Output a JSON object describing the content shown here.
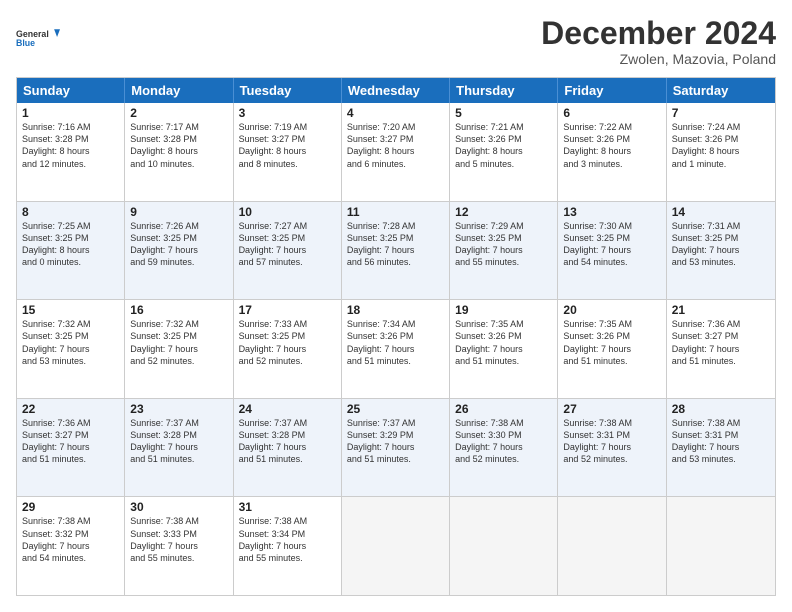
{
  "logo": {
    "line1": "General",
    "line2": "Blue"
  },
  "header": {
    "title": "December 2024",
    "subtitle": "Zwolen, Mazovia, Poland"
  },
  "calendar": {
    "days_of_week": [
      "Sunday",
      "Monday",
      "Tuesday",
      "Wednesday",
      "Thursday",
      "Friday",
      "Saturday"
    ],
    "weeks": [
      [
        {
          "day": "",
          "detail": ""
        },
        {
          "day": "2",
          "detail": "Sunrise: 7:17 AM\nSunset: 3:28 PM\nDaylight: 8 hours\nand 10 minutes."
        },
        {
          "day": "3",
          "detail": "Sunrise: 7:19 AM\nSunset: 3:27 PM\nDaylight: 8 hours\nand 8 minutes."
        },
        {
          "day": "4",
          "detail": "Sunrise: 7:20 AM\nSunset: 3:27 PM\nDaylight: 8 hours\nand 6 minutes."
        },
        {
          "day": "5",
          "detail": "Sunrise: 7:21 AM\nSunset: 3:26 PM\nDaylight: 8 hours\nand 5 minutes."
        },
        {
          "day": "6",
          "detail": "Sunrise: 7:22 AM\nSunset: 3:26 PM\nDaylight: 8 hours\nand 3 minutes."
        },
        {
          "day": "7",
          "detail": "Sunrise: 7:24 AM\nSunset: 3:26 PM\nDaylight: 8 hours\nand 1 minute."
        }
      ],
      [
        {
          "day": "1",
          "detail": "Sunrise: 7:16 AM\nSunset: 3:28 PM\nDaylight: 8 hours\nand 12 minutes."
        },
        {
          "day": "9",
          "detail": "Sunrise: 7:26 AM\nSunset: 3:25 PM\nDaylight: 7 hours\nand 59 minutes."
        },
        {
          "day": "10",
          "detail": "Sunrise: 7:27 AM\nSunset: 3:25 PM\nDaylight: 7 hours\nand 57 minutes."
        },
        {
          "day": "11",
          "detail": "Sunrise: 7:28 AM\nSunset: 3:25 PM\nDaylight: 7 hours\nand 56 minutes."
        },
        {
          "day": "12",
          "detail": "Sunrise: 7:29 AM\nSunset: 3:25 PM\nDaylight: 7 hours\nand 55 minutes."
        },
        {
          "day": "13",
          "detail": "Sunrise: 7:30 AM\nSunset: 3:25 PM\nDaylight: 7 hours\nand 54 minutes."
        },
        {
          "day": "14",
          "detail": "Sunrise: 7:31 AM\nSunset: 3:25 PM\nDaylight: 7 hours\nand 53 minutes."
        }
      ],
      [
        {
          "day": "8",
          "detail": "Sunrise: 7:25 AM\nSunset: 3:25 PM\nDaylight: 8 hours\nand 0 minutes."
        },
        {
          "day": "16",
          "detail": "Sunrise: 7:32 AM\nSunset: 3:25 PM\nDaylight: 7 hours\nand 52 minutes."
        },
        {
          "day": "17",
          "detail": "Sunrise: 7:33 AM\nSunset: 3:25 PM\nDaylight: 7 hours\nand 52 minutes."
        },
        {
          "day": "18",
          "detail": "Sunrise: 7:34 AM\nSunset: 3:26 PM\nDaylight: 7 hours\nand 51 minutes."
        },
        {
          "day": "19",
          "detail": "Sunrise: 7:35 AM\nSunset: 3:26 PM\nDaylight: 7 hours\nand 51 minutes."
        },
        {
          "day": "20",
          "detail": "Sunrise: 7:35 AM\nSunset: 3:26 PM\nDaylight: 7 hours\nand 51 minutes."
        },
        {
          "day": "21",
          "detail": "Sunrise: 7:36 AM\nSunset: 3:27 PM\nDaylight: 7 hours\nand 51 minutes."
        }
      ],
      [
        {
          "day": "15",
          "detail": "Sunrise: 7:32 AM\nSunset: 3:25 PM\nDaylight: 7 hours\nand 53 minutes."
        },
        {
          "day": "23",
          "detail": "Sunrise: 7:37 AM\nSunset: 3:28 PM\nDaylight: 7 hours\nand 51 minutes."
        },
        {
          "day": "24",
          "detail": "Sunrise: 7:37 AM\nSunset: 3:28 PM\nDaylight: 7 hours\nand 51 minutes."
        },
        {
          "day": "25",
          "detail": "Sunrise: 7:37 AM\nSunset: 3:29 PM\nDaylight: 7 hours\nand 51 minutes."
        },
        {
          "day": "26",
          "detail": "Sunrise: 7:38 AM\nSunset: 3:30 PM\nDaylight: 7 hours\nand 52 minutes."
        },
        {
          "day": "27",
          "detail": "Sunrise: 7:38 AM\nSunset: 3:31 PM\nDaylight: 7 hours\nand 52 minutes."
        },
        {
          "day": "28",
          "detail": "Sunrise: 7:38 AM\nSunset: 3:31 PM\nDaylight: 7 hours\nand 53 minutes."
        }
      ],
      [
        {
          "day": "22",
          "detail": "Sunrise: 7:36 AM\nSunset: 3:27 PM\nDaylight: 7 hours\nand 51 minutes."
        },
        {
          "day": "30",
          "detail": "Sunrise: 7:38 AM\nSunset: 3:33 PM\nDaylight: 7 hours\nand 55 minutes."
        },
        {
          "day": "31",
          "detail": "Sunrise: 7:38 AM\nSunset: 3:34 PM\nDaylight: 7 hours\nand 55 minutes."
        },
        {
          "day": "",
          "detail": ""
        },
        {
          "day": "",
          "detail": ""
        },
        {
          "day": "",
          "detail": ""
        },
        {
          "day": "",
          "detail": ""
        }
      ],
      [
        {
          "day": "29",
          "detail": "Sunrise: 7:38 AM\nSunset: 3:32 PM\nDaylight: 7 hours\nand 54 minutes."
        },
        {
          "day": "",
          "detail": ""
        },
        {
          "day": "",
          "detail": ""
        },
        {
          "day": "",
          "detail": ""
        },
        {
          "day": "",
          "detail": ""
        },
        {
          "day": "",
          "detail": ""
        },
        {
          "day": "",
          "detail": ""
        }
      ]
    ]
  }
}
